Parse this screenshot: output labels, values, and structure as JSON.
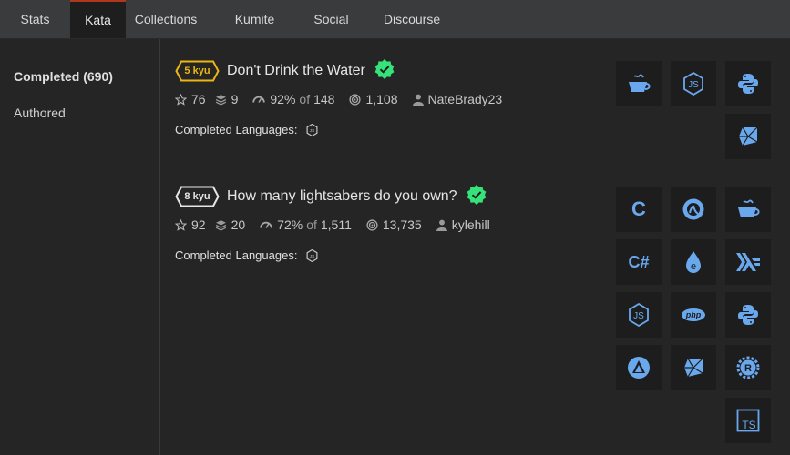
{
  "tabs": [
    {
      "label": "Stats"
    },
    {
      "label": "Kata"
    },
    {
      "label": "Collections"
    },
    {
      "label": "Kumite"
    },
    {
      "label": "Social"
    },
    {
      "label": "Discourse"
    }
  ],
  "active_tab": "Kata",
  "sidebar": {
    "items": [
      {
        "label": "Completed (690)"
      },
      {
        "label": "Authored"
      }
    ]
  },
  "colors": {
    "accent_tab_border": "#b1361e",
    "kyu5": "#ecb613",
    "kyu8": "#e6e6e6",
    "verified": "#36e27a",
    "icon_blue": "#6aa8ee"
  },
  "katas": [
    {
      "kyu": "5 kyu",
      "name": "Don't Drink the Water",
      "stars": "76",
      "collections": "9",
      "satisfaction": "92%",
      "of_label": "of",
      "votes": "148",
      "completions": "1,108",
      "author": "NateBrady23",
      "completed_languages_label": "Completed Languages:",
      "completed_languages": [
        "javascript-icon"
      ],
      "languages": [
        "coffeescript-icon",
        "javascript-icon",
        "python-icon",
        "ruby-icon"
      ]
    },
    {
      "kyu": "8 kyu",
      "name": "How many lightsabers do you own?",
      "stars": "92",
      "collections": "20",
      "satisfaction": "72%",
      "of_label": "of",
      "votes": "1,511",
      "completions": "13,735",
      "author": "kylehill",
      "completed_languages_label": "Completed Languages:",
      "completed_languages": [
        "javascript-icon"
      ],
      "languages": [
        "c-icon",
        "clojure-icon",
        "coffeescript-icon",
        "csharp-icon",
        "elixir-icon",
        "haskell-icon",
        "javascript-icon",
        "php-icon",
        "python-icon",
        "crystal-icon",
        "ruby-icon",
        "rust-icon",
        "typescript-icon"
      ]
    }
  ],
  "lang_text": {
    "c": "C",
    "csharp": "C#",
    "php": "php",
    "ts": "TS",
    "js": "JS"
  }
}
